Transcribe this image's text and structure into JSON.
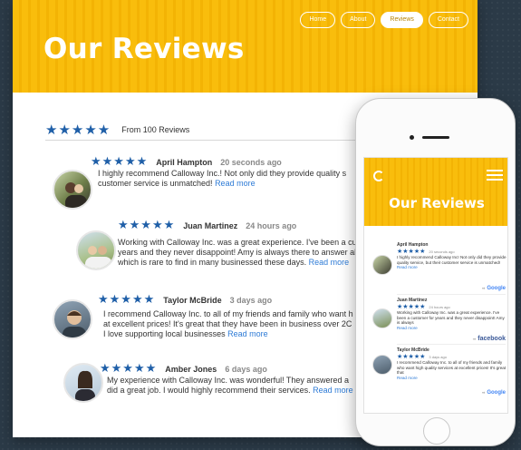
{
  "hero": {
    "title": "Our Reviews"
  },
  "nav": {
    "items": [
      "Home",
      "About",
      "Reviews",
      "Contact"
    ],
    "active": "Reviews"
  },
  "summary": {
    "stars": "★★★★★",
    "text": "From 100 Reviews"
  },
  "reviews": [
    {
      "name": "April Hampton",
      "time": "20 seconds ago",
      "stars": "★★★★★",
      "lines": [
        "I highly recommend Calloway Inc.! Not only did they provide quality s",
        "customer service is unmatched! "
      ],
      "more": "Read more"
    },
    {
      "name": "Juan Martinez",
      "time": "24 hours ago",
      "stars": "★★★★★",
      "lines": [
        "Working with Calloway Inc. was a great experience. I've been a cusc",
        "years and they never disappoint! Amy is always there to answer all n",
        "which is rare to find in many businessed these days. "
      ],
      "more": "Read more"
    },
    {
      "name": "Taylor McBride",
      "time": "3 days ago",
      "stars": "★★★★★",
      "lines": [
        "I recommend Calloway Inc. to all of my friends and family who want h",
        "at excellent prices! It's great that they have been in business over 2C",
        "I love supporting local businesses "
      ],
      "more": "Read more"
    },
    {
      "name": "Amber Jones",
      "time": "6 days ago",
      "stars": "★★★★★",
      "lines": [
        "My experience with Calloway Inc. was wonderful! They answered a",
        "did a great job. I would highly recommend their services. "
      ],
      "more": "Read more"
    }
  ],
  "mobile": {
    "title": "Our Reviews",
    "reviews": [
      {
        "name": "April Hampton",
        "time": "20 seconds ago",
        "stars": "★★★★★",
        "text": "I highly recommend Calloway Inc! Not only did they provide quality service, but their customer service is unmatched!",
        "more": "Read more",
        "source": "Google"
      },
      {
        "name": "Juan Martinez",
        "time": "24 hours ago",
        "stars": "★★★★★",
        "text": "Working with Calloway Inc. was a great experience. I've been a customer for years and they never disappoint! Amy is always",
        "more": "Read more",
        "source": "facebook"
      },
      {
        "name": "Taylor McBride",
        "time": "3 days ago",
        "stars": "★★★★★",
        "text": "I recommend Calloway Inc. to all of my friends and family who want high quality services at excellent prices! It's great that",
        "more": "Read more",
        "source": "Google"
      }
    ]
  },
  "colors": {
    "brand_yellow": "#f9bd0c",
    "star_blue": "#1f5fa8",
    "link_blue": "#2e7bd6",
    "facebook_blue": "#3b5998"
  }
}
